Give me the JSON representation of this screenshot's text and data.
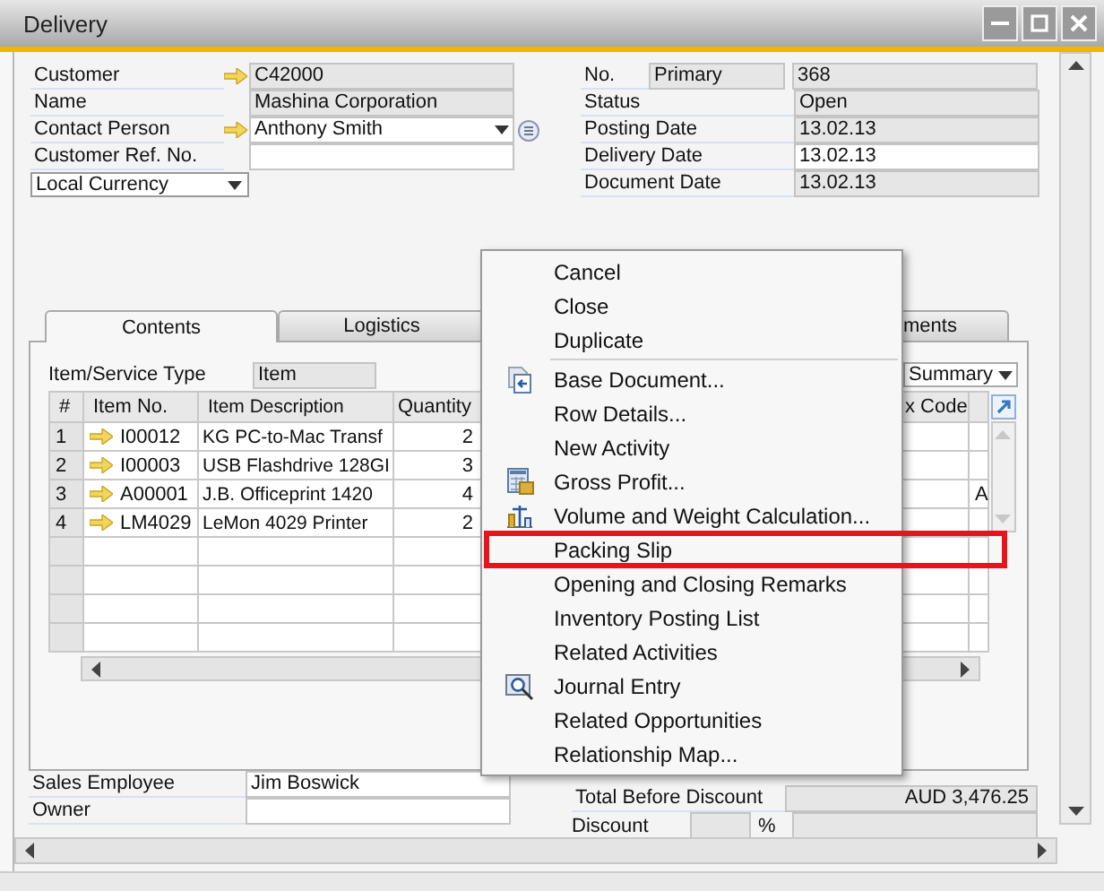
{
  "window": {
    "title": "Delivery"
  },
  "header_left": [
    {
      "label": "Customer",
      "value": "C42000",
      "link": true,
      "editable": false,
      "dropdown": false,
      "list_button": false
    },
    {
      "label": "Name",
      "value": "Mashina Corporation",
      "link": false,
      "editable": false,
      "dropdown": false,
      "list_button": false
    },
    {
      "label": "Contact Person",
      "value": "Anthony Smith",
      "link": true,
      "editable": true,
      "dropdown": true,
      "list_button": true
    },
    {
      "label": "Customer Ref. No.",
      "link": false,
      "editable": true,
      "dropdown": false,
      "list_button": false
    }
  ],
  "currency": {
    "value": "Local Currency"
  },
  "header_right": [
    {
      "label": "No.",
      "series": "Primary",
      "value": "368",
      "editable": false
    },
    {
      "label": "Status",
      "value": "Open",
      "editable": false
    },
    {
      "label": "Posting Date",
      "value": "13.02.13",
      "editable": false
    },
    {
      "label": "Delivery Date",
      "value": "13.02.13",
      "editable": true
    },
    {
      "label": "Document Date",
      "value": "13.02.13",
      "editable": false
    }
  ],
  "tabs": [
    {
      "label": "Contents",
      "selected": true
    },
    {
      "label": "Logistics",
      "selected": false
    },
    {
      "label": "ments",
      "selected": false
    }
  ],
  "item_type": {
    "label": "Item/Service Type",
    "value": "Item"
  },
  "summary": {
    "value": "Summary"
  },
  "table": {
    "columns": [
      "#",
      "Item No.",
      "Item Description",
      "Quantity",
      "x Code"
    ],
    "rows": [
      {
        "number": "1",
        "item_no": "I00012",
        "description": "KG PC-to-Mac Transf",
        "quantity": "2",
        "column_7": ""
      },
      {
        "number": "2",
        "item_no": "I00003",
        "description": "USB Flashdrive 128GI",
        "quantity": "3",
        "column_7": ""
      },
      {
        "number": "3",
        "item_no": "A00001",
        "description": "J.B. Officeprint 1420",
        "quantity": "4",
        "column_7": "A"
      },
      {
        "number": "4",
        "item_no": "LM4029",
        "description": "LeMon 4029 Printer",
        "quantity": "2",
        "column_7": ""
      }
    ]
  },
  "footer_left": [
    {
      "label": "Sales Employee",
      "value": "Jim Boswick"
    },
    {
      "label": "Owner"
    }
  ],
  "totals": {
    "total_label": "Total Before Discount",
    "total_value": "AUD 3,476.25",
    "discount_label": "Discount",
    "percent": "%"
  },
  "context_menu": {
    "items": [
      {
        "label": "Cancel",
        "kind": "plain",
        "separator_before": false,
        "highlighted": false
      },
      {
        "label": "Close",
        "kind": "plain",
        "separator_before": false,
        "highlighted": false
      },
      {
        "label": "Duplicate",
        "kind": "plain",
        "separator_before": false,
        "highlighted": false
      },
      {
        "label": "Base Document...",
        "kind": "document",
        "separator_before": true,
        "highlighted": false
      },
      {
        "label": "Row Details...",
        "kind": "plain",
        "separator_before": false,
        "highlighted": false
      },
      {
        "label": "New Activity",
        "kind": "plain",
        "separator_before": false,
        "highlighted": false
      },
      {
        "label": "Gross Profit...",
        "kind": "calculator",
        "separator_before": false,
        "highlighted": false
      },
      {
        "label": "Volume and Weight Calculation...",
        "kind": "scale",
        "separator_before": false,
        "highlighted": false
      },
      {
        "label": "Packing Slip",
        "kind": "plain",
        "separator_before": false,
        "highlighted": true
      },
      {
        "label": "Opening and Closing Remarks",
        "kind": "plain",
        "separator_before": false,
        "highlighted": false
      },
      {
        "label": "Inventory Posting List",
        "kind": "plain",
        "separator_before": false,
        "highlighted": false
      },
      {
        "label": "Related Activities",
        "kind": "plain",
        "separator_before": false,
        "highlighted": false
      },
      {
        "label": "Journal Entry",
        "kind": "magnifier",
        "separator_before": false,
        "highlighted": false
      },
      {
        "label": "Related Opportunities",
        "kind": "plain",
        "separator_before": false,
        "highlighted": false
      },
      {
        "label": "Relationship Map...",
        "kind": "plain",
        "separator_before": false,
        "highlighted": false
      }
    ]
  }
}
